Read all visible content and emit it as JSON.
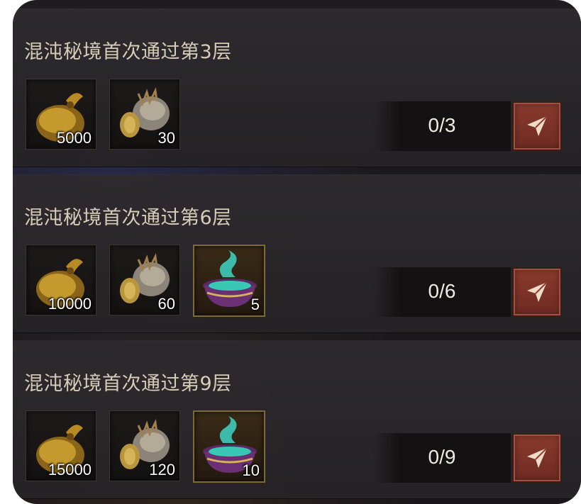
{
  "tasks": [
    {
      "title": "混沌秘境首次通过第3层",
      "rewards": [
        {
          "icon": "gold-bag-icon",
          "count": "5000"
        },
        {
          "icon": "helmet-icon",
          "count": "30"
        }
      ],
      "progress": "0/3"
    },
    {
      "title": "混沌秘境首次通过第6层",
      "rewards": [
        {
          "icon": "gold-bag-icon",
          "count": "10000"
        },
        {
          "icon": "helmet-icon",
          "count": "60"
        },
        {
          "icon": "cauldron-icon",
          "count": "5"
        }
      ],
      "progress": "0/6"
    },
    {
      "title": "混沌秘境首次通过第9层",
      "rewards": [
        {
          "icon": "gold-bag-icon",
          "count": "15000"
        },
        {
          "icon": "helmet-icon",
          "count": "120"
        },
        {
          "icon": "cauldron-icon",
          "count": "10"
        }
      ],
      "progress": "0/9"
    }
  ],
  "colors": {
    "title": "#d6ccb8",
    "button": "#8a3a2e",
    "rare_border": "#7d6a36"
  }
}
